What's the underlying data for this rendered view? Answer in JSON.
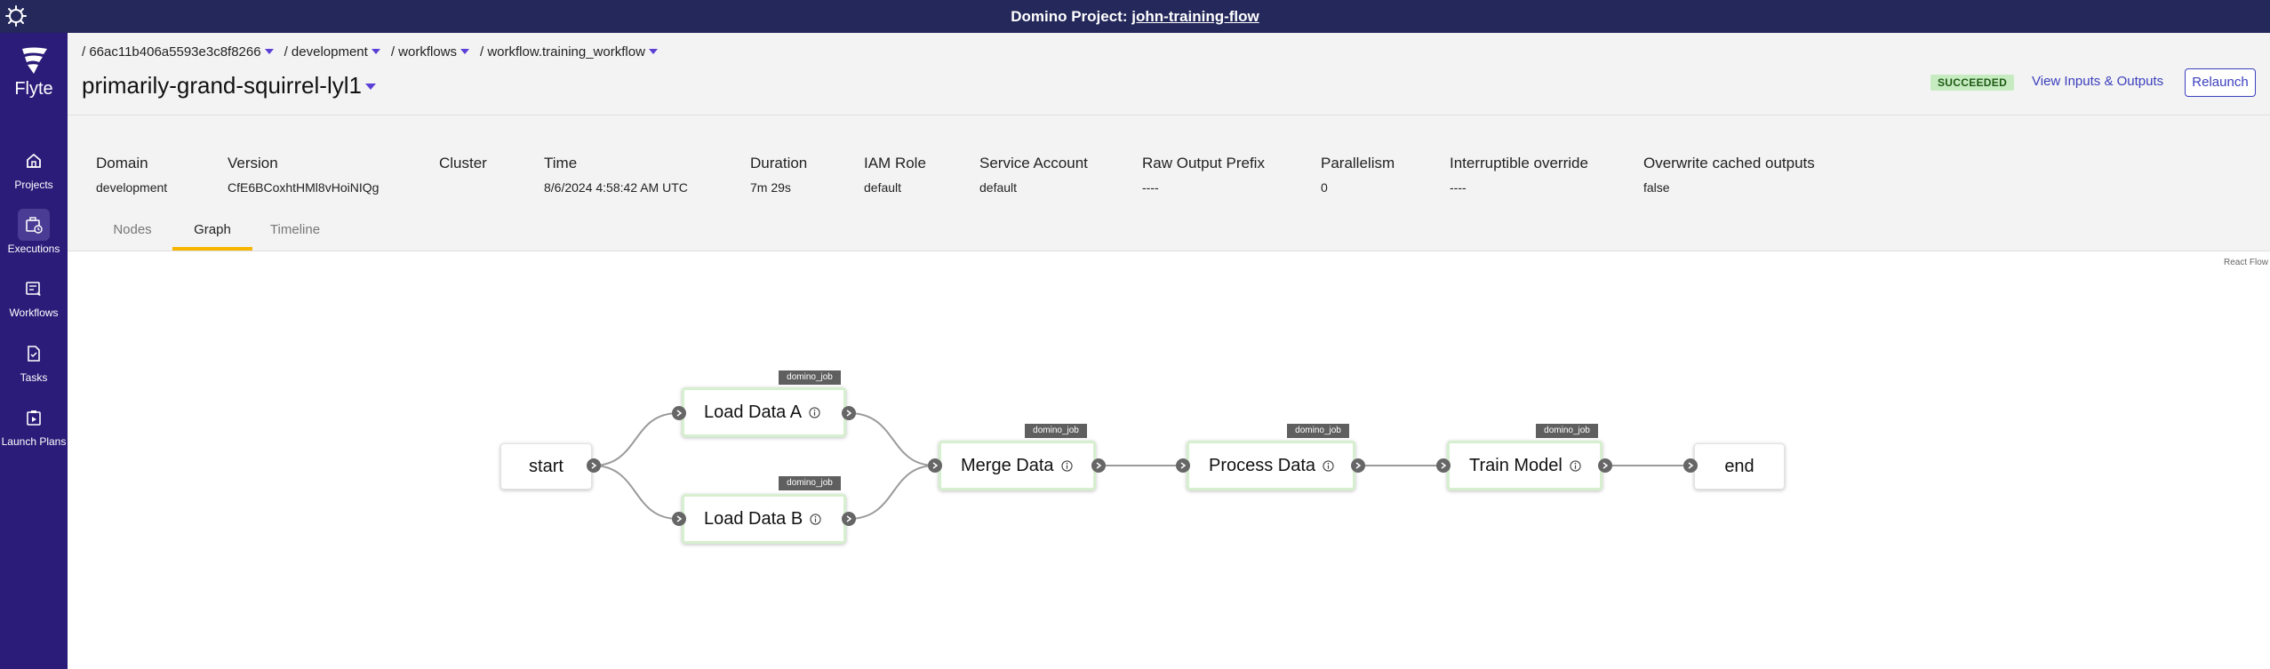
{
  "banner": {
    "prefix": "Domino Project: ",
    "project_link": "john-training-flow"
  },
  "brand": {
    "name": "Flyte"
  },
  "nav": {
    "items": [
      {
        "label": "Projects",
        "icon": "home-icon"
      },
      {
        "label": "Executions",
        "icon": "executions-icon",
        "active": true
      },
      {
        "label": "Workflows",
        "icon": "workflows-icon"
      },
      {
        "label": "Tasks",
        "icon": "tasks-icon"
      },
      {
        "label": "Launch Plans",
        "icon": "launch-plans-icon"
      }
    ]
  },
  "breadcrumb": {
    "project": "/ 66ac11b406a5593e3c8f8266",
    "domain": "/ development",
    "section": "/ workflows",
    "workflow": "/ workflow.training_workflow"
  },
  "execution": {
    "name": "primarily-grand-squirrel-lyl1",
    "status": "SUCCEEDED",
    "view_io_label": "View Inputs & Outputs",
    "relaunch_label": "Relaunch"
  },
  "details": [
    {
      "label": "Domain",
      "value": "development"
    },
    {
      "label": "Version",
      "value": "CfE6BCoxhtHMl8vHoiNIQg"
    },
    {
      "label": "Cluster",
      "value": ""
    },
    {
      "label": "Time",
      "value": "8/6/2024 4:58:42 AM UTC"
    },
    {
      "label": "Duration",
      "value": "7m 29s"
    },
    {
      "label": "IAM Role",
      "value": "default"
    },
    {
      "label": "Service Account",
      "value": "default"
    },
    {
      "label": "Raw Output Prefix",
      "value": "----"
    },
    {
      "label": "Parallelism",
      "value": "0"
    },
    {
      "label": "Interruptible override",
      "value": "----"
    },
    {
      "label": "Overwrite cached outputs",
      "value": "false"
    }
  ],
  "tabs": {
    "nodes": "Nodes",
    "graph": "Graph",
    "timeline": "Timeline",
    "active": "Graph"
  },
  "graph": {
    "attribution": "React Flow",
    "nodes": {
      "start": "start",
      "load_a": "Load Data A",
      "load_b": "Load Data B",
      "merge": "Merge Data",
      "process": "Process Data",
      "train": "Train Model",
      "end": "end"
    },
    "task_tag": "domino_job"
  }
}
